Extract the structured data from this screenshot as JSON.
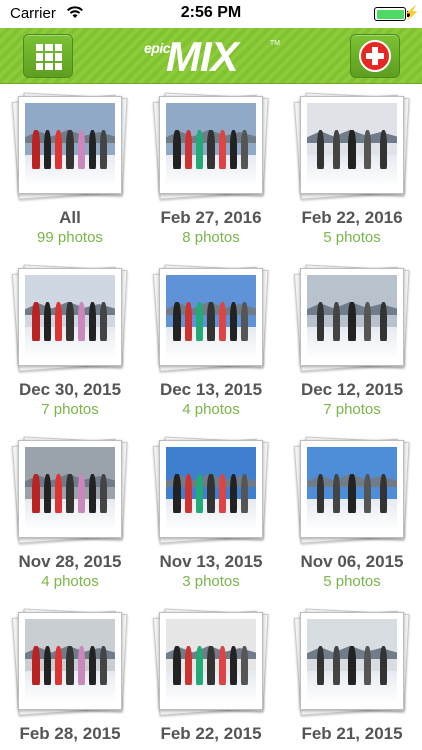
{
  "status": {
    "carrier": "Carrier",
    "time": "2:56 PM"
  },
  "nav": {
    "logo_small": "epic",
    "logo_big": "MIX",
    "logo_tm": "TM",
    "grid_icon": "grid-icon",
    "help_icon": "red-cross-icon"
  },
  "albums": [
    {
      "label": "All",
      "count": "99 photos",
      "sky": "#8fa9c6"
    },
    {
      "label": "Feb 27, 2016",
      "count": "8 photos",
      "sky": "#8fa9c6"
    },
    {
      "label": "Feb 22, 2016",
      "count": "5 photos",
      "sky": "#dfe3e8"
    },
    {
      "label": "Dec 30, 2015",
      "count": "7 photos",
      "sky": "#cfd8e2"
    },
    {
      "label": "Dec 13, 2015",
      "count": "4 photos",
      "sky": "#5f92d6"
    },
    {
      "label": "Dec 12, 2015",
      "count": "7 photos",
      "sky": "#b7c2cd"
    },
    {
      "label": "Nov 28, 2015",
      "count": "4 photos",
      "sky": "#9aa3ab"
    },
    {
      "label": "Nov 13, 2015",
      "count": "3 photos",
      "sky": "#3f7fd0"
    },
    {
      "label": "Nov 06, 2015",
      "count": "5 photos",
      "sky": "#4e8ed8"
    },
    {
      "label": "Feb 28, 2015",
      "count": "",
      "sky": "#c9ced3"
    },
    {
      "label": "Feb 22, 2015",
      "count": "",
      "sky": "#e6e6e6"
    },
    {
      "label": "Feb 21, 2015",
      "count": "",
      "sky": "#d8dde2"
    }
  ]
}
